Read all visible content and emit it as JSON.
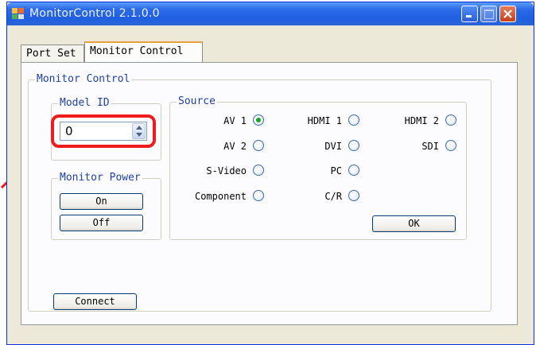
{
  "window": {
    "title": "MonitorControl  2.1.0.0"
  },
  "tabs": [
    {
      "label": "Port Set",
      "active": false
    },
    {
      "label": "Monitor Control",
      "active": true
    }
  ],
  "monitor_control": {
    "label": "Monitor Control",
    "model_id": {
      "label": "Model ID",
      "value": "0"
    },
    "monitor_power": {
      "label": "Monitor Power",
      "on_label": "On",
      "off_label": "Off"
    },
    "source": {
      "label": "Source",
      "options": [
        {
          "label": "AV 1",
          "selected": true
        },
        {
          "label": "HDMI 1",
          "selected": false
        },
        {
          "label": "HDMI 2",
          "selected": false
        },
        {
          "label": "AV 2",
          "selected": false
        },
        {
          "label": "DVI",
          "selected": false
        },
        {
          "label": "SDI",
          "selected": false
        },
        {
          "label": "S-Video",
          "selected": false
        },
        {
          "label": "PC",
          "selected": false
        },
        {
          "label": "Component",
          "selected": false
        },
        {
          "label": "C/R",
          "selected": false
        }
      ],
      "ok_label": "OK"
    },
    "connect_label": "Connect"
  },
  "colors": {
    "highlight": "#ee1c1c",
    "accent_tab": "#e8a33c",
    "legend_text": "#1e3fa8",
    "radio_checked": "#21a121"
  }
}
